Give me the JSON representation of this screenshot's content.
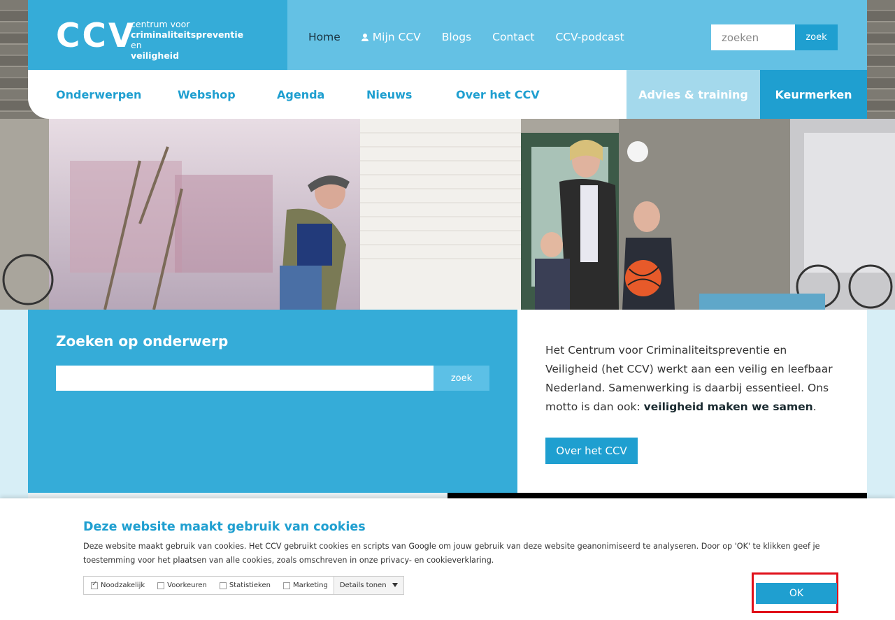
{
  "header": {
    "logo_mark": "CCV",
    "logo_line1": "centrum voor",
    "logo_line2": "criminaliteitspreventie",
    "logo_line2_suffix": "en",
    "logo_line3": "veiligheid",
    "topnav": [
      {
        "label": "Home",
        "active": true
      },
      {
        "label": "Mijn CCV",
        "icon": "user-icon"
      },
      {
        "label": "Blogs"
      },
      {
        "label": "Contact"
      },
      {
        "label": "CCV-podcast"
      }
    ],
    "search": {
      "placeholder": "zoeken",
      "button_label": "zoek"
    }
  },
  "mainnav": {
    "items": [
      "Onderwerpen",
      "Webshop",
      "Agenda",
      "Nieuws",
      "Over het CCV"
    ],
    "advies_label": "Advies & training",
    "keurmerken_label": "Keurmerken"
  },
  "search_panel": {
    "title": "Zoeken op onderwerp",
    "input_value": "",
    "button_label": "zoek"
  },
  "about": {
    "text": "Het Centrum voor Criminaliteitspreventie en Veiligheid (het CCV) werkt aan een veilig en leefbaar Nederland. Samenwerking is daarbij essentieel. Ons motto is dan ook: ",
    "motto": "veiligheid maken we samen",
    "motto_end": ".",
    "button_label": "Over het CCV"
  },
  "cookie": {
    "title": "Deze website maakt gebruik van cookies",
    "description": "Deze website maakt gebruik van cookies. Het CCV gebruikt cookies en scripts van Google om jouw gebruik van deze website geanonimiseerd te analyseren. Door op 'OK' te klikken geef je toestemming voor het plaatsen van alle cookies, zoals omschreven in onze privacy- en cookieverklaring.",
    "options": [
      {
        "label": "Noodzakelijk",
        "checked": true
      },
      {
        "label": "Voorkeuren",
        "checked": false
      },
      {
        "label": "Statistieken",
        "checked": false
      },
      {
        "label": "Marketing",
        "checked": false
      }
    ],
    "details_label": "Details tonen",
    "ok_label": "OK"
  },
  "colors": {
    "brand_blue": "#35acd8",
    "dark_blue": "#1f9fd0",
    "light_blue": "#64c1e4",
    "highlight_red": "#e0101a"
  }
}
